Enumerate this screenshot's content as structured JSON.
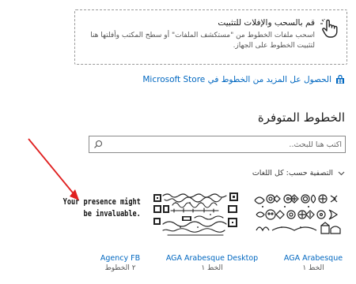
{
  "drop_zone": {
    "title": "قم بالسحب والإفلات للتثبيت",
    "description": "اسحب ملفات الخطوط من \"مستكشف الملفات\" أو سطح المكتب وأفلتها هنا لتثبيت الخطوط على الجهاز.",
    "icon": "hand-pointer-icon"
  },
  "store_link": {
    "label": "الحصول عل المزيد من الخطوط في Microsoft Store",
    "icon": "store-bag-icon"
  },
  "section_title": "الخطوط المتوفرة",
  "search": {
    "placeholder": "اكتب هنا للبحث..",
    "icon": "search-icon"
  },
  "filter": {
    "label": "التصفية حسب: كل اللغات",
    "icon": "chevron-down-icon"
  },
  "previews": {
    "agency_text": "Your presence might be invaluable."
  },
  "fonts": [
    {
      "name": "Agency FB",
      "count": "٢ الخطوط"
    },
    {
      "name": "AGA Arabesque Desktop",
      "count": "الخط ١"
    },
    {
      "name": "AGA Arabesque",
      "count": "الخط ١"
    }
  ],
  "accent_color": "#0067c0",
  "annotation_color": "#e02020"
}
